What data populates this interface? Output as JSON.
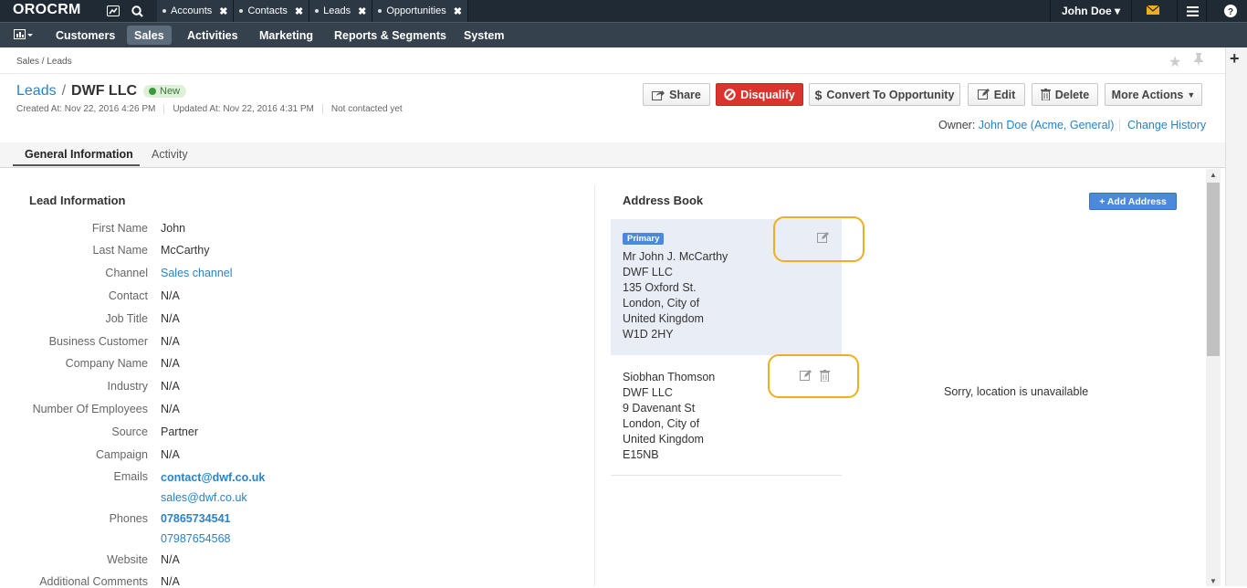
{
  "topbar": {
    "logo": "OROCRM",
    "pinned_tabs": [
      "Accounts",
      "Contacts",
      "Leads",
      "Opportunities"
    ],
    "user_name": "John Doe",
    "user_caret": "▾"
  },
  "nav": {
    "items": [
      "Customers",
      "Sales",
      "Activities",
      "Marketing",
      "Reports & Segments",
      "System"
    ],
    "active": "Sales"
  },
  "breadcrumb": "Sales / Leads",
  "record": {
    "entity_link": "Leads",
    "separator": "/",
    "name": "DWF LLC",
    "status": "New",
    "created": "Created At: Nov 22, 2016 4:26 PM",
    "updated": "Updated At: Nov 22, 2016 4:31 PM",
    "contacted": "Not contacted yet"
  },
  "actions": {
    "share": "Share",
    "disqualify": "Disqualify",
    "convert": "Convert To Opportunity",
    "edit": "Edit",
    "delete": "Delete",
    "more": "More Actions"
  },
  "owner": {
    "prefix": "Owner:",
    "name": "John Doe",
    "org": "(Acme, General)",
    "change_history": "Change History"
  },
  "tabs": [
    "General Information",
    "Activity"
  ],
  "lead_info": {
    "title": "Lead Information",
    "fields": [
      {
        "label": "First Name",
        "value": "John"
      },
      {
        "label": "Last Name",
        "value": "McCarthy"
      },
      {
        "label": "Channel",
        "value": "Sales channel"
      },
      {
        "label": "Contact",
        "value": "N/A"
      },
      {
        "label": "Job Title",
        "value": "N/A"
      },
      {
        "label": "Business Customer",
        "value": "N/A"
      },
      {
        "label": "Company Name",
        "value": "N/A"
      },
      {
        "label": "Industry",
        "value": "N/A"
      },
      {
        "label": "Number Of Employees",
        "value": "N/A"
      },
      {
        "label": "Source",
        "value": "Partner"
      },
      {
        "label": "Campaign",
        "value": "N/A"
      }
    ],
    "emails_label": "Emails",
    "emails": [
      "contact@dwf.co.uk",
      "sales@dwf.co.uk"
    ],
    "phones_label": "Phones",
    "phones": [
      "07865734541",
      "07987654568"
    ],
    "website_label": "Website",
    "website": "N/A",
    "comments_label": "Additional Comments",
    "comments": "N/A"
  },
  "address_book": {
    "title": "Address Book",
    "add_button": "+ Add Address",
    "primary_badge": "Primary",
    "addresses": [
      {
        "lines": [
          "Mr John J. McCarthy",
          "DWF LLC",
          "135 Oxford St.",
          "London, City of",
          "United Kingdom",
          "W1D 2HY"
        ]
      },
      {
        "lines": [
          "Siobhan Thomson",
          "DWF LLC",
          "9 Davenant St",
          "London, City of",
          "United Kingdom",
          "E15NB"
        ]
      }
    ],
    "map_message": "Sorry, location is unavailable"
  },
  "colors": {
    "topbar": "#1f2a35",
    "nav": "#35414d",
    "link": "#2a82c8",
    "disqualify": "#d9352c",
    "highlight": "#f0ad1e",
    "primary_badge": "#4a89dc"
  },
  "icons": [
    "dashboard-icon",
    "search-icon",
    "share-icon",
    "ban-icon",
    "dollar-icon",
    "edit-icon",
    "trash-icon",
    "star-icon",
    "pin-icon",
    "mail-icon",
    "menu-icon",
    "help-icon"
  ]
}
